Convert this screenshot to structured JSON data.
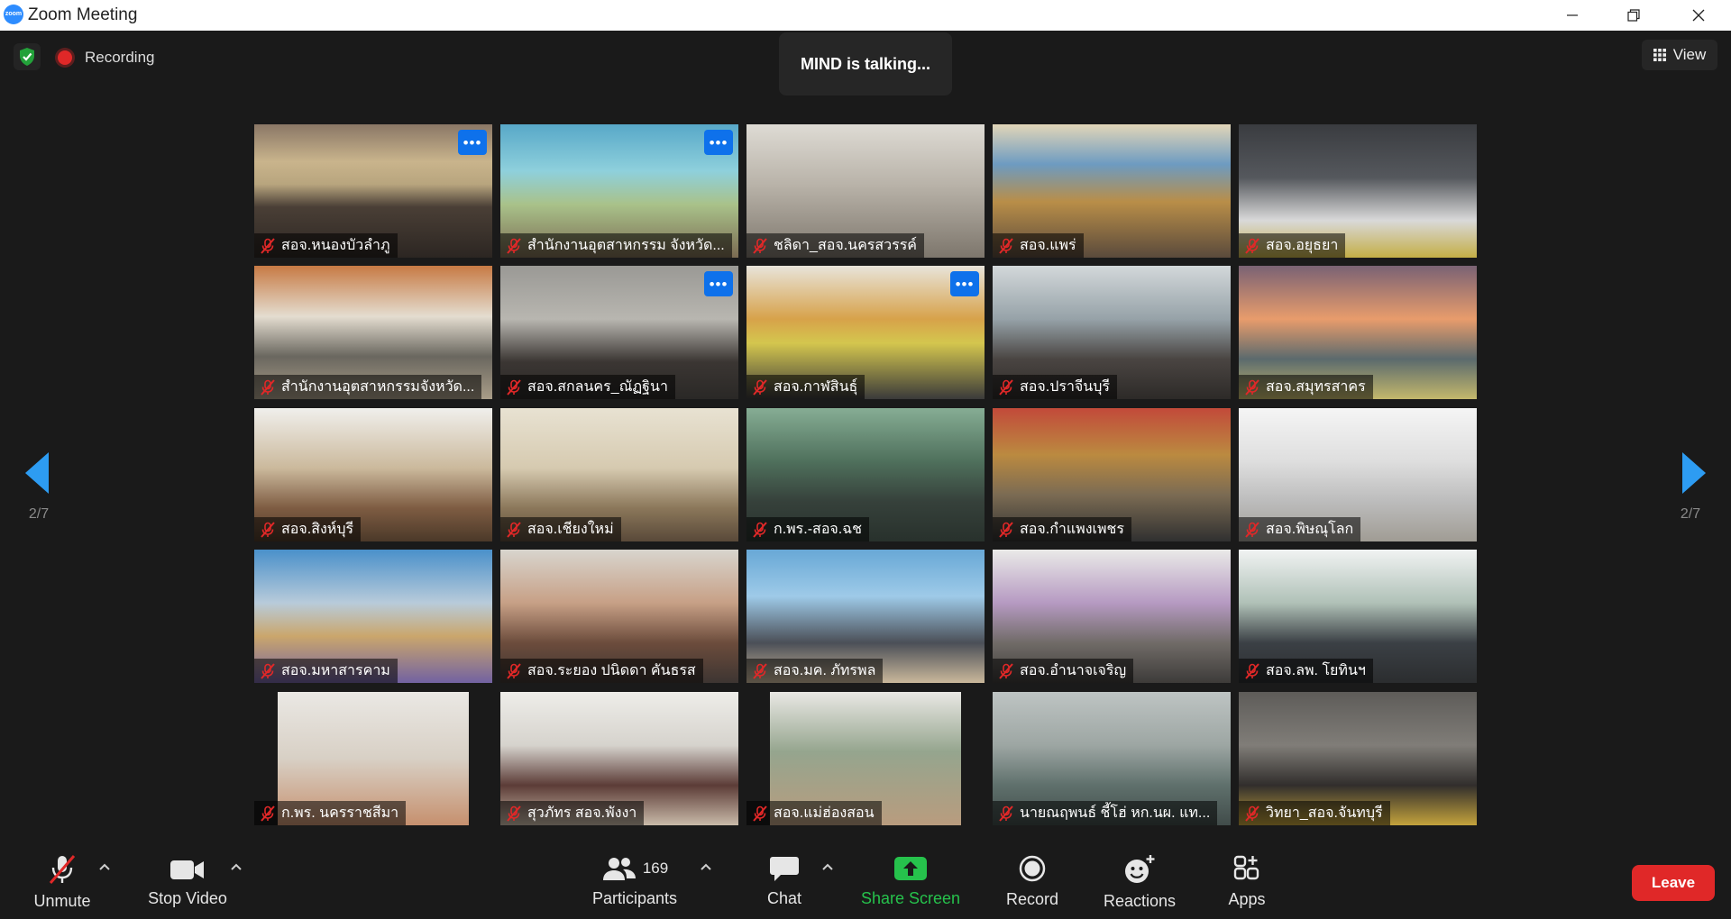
{
  "window": {
    "title": "Zoom Meeting",
    "logo": "zoom"
  },
  "topbar": {
    "recording_label": "Recording",
    "talking_text": "MIND is talking...",
    "view_label": "View"
  },
  "pagination": {
    "left": "2/7",
    "right": "2/7"
  },
  "participants": [
    {
      "name": "สอจ.หนองบัวลำภู",
      "more_button": true
    },
    {
      "name": "สำนักงานอุตสาหกรรม จังหวัด...",
      "more_button": true
    },
    {
      "name": "ชลิดา_สอจ.นครสวรรค์",
      "more_button": false
    },
    {
      "name": "สอจ.แพร่",
      "more_button": false
    },
    {
      "name": "สอจ.อยุธยา",
      "more_button": false
    },
    {
      "name": "สำนักงานอุตสาหกรรมจังหวัด...",
      "more_button": false
    },
    {
      "name": "สอจ.สกลนคร_ณัฏฐินา",
      "more_button": true
    },
    {
      "name": "สอจ.กาฬสินธุ์",
      "more_button": true
    },
    {
      "name": "สอจ.ปราจีนบุรี",
      "more_button": false
    },
    {
      "name": "สอจ.สมุทรสาคร",
      "more_button": false
    },
    {
      "name": "สอจ.สิงห์บุรี",
      "more_button": false
    },
    {
      "name": "สอจ.เชียงใหม่",
      "more_button": false
    },
    {
      "name": "ก.พร.-สอจ.ฉช",
      "more_button": false
    },
    {
      "name": "สอจ.กำแพงเพชร",
      "more_button": false
    },
    {
      "name": "สอจ.พิษณุโลก",
      "more_button": false
    },
    {
      "name": "สอจ.มหาสารคาม",
      "more_button": false
    },
    {
      "name": "สอจ.ระยอง ปนิดดา คันธรส",
      "more_button": false
    },
    {
      "name": "สอจ.มค. ภัทรพล",
      "more_button": false
    },
    {
      "name": "สอจ.อำนาจเจริญ",
      "more_button": false
    },
    {
      "name": "สอจ.ลพ. โยทินฯ",
      "more_button": false
    },
    {
      "name": "ก.พร. นครราชสีมา",
      "more_button": false
    },
    {
      "name": "สุวภัทร สอจ.พังงา",
      "more_button": false
    },
    {
      "name": "สอจ.แม่ฮ่องสอน",
      "more_button": false
    },
    {
      "name": "นายณฤพนธ์ ชี้โฮ่ หก.นผ. แท...",
      "more_button": false
    },
    {
      "name": "วิทยา_สอจ.จันทบุรี",
      "more_button": false
    }
  ],
  "toolbar": {
    "unmute": "Unmute",
    "stop_video": "Stop Video",
    "participants": "Participants",
    "participant_count": "169",
    "chat": "Chat",
    "share_screen": "Share Screen",
    "record": "Record",
    "reactions": "Reactions",
    "apps": "Apps",
    "leave": "Leave"
  },
  "colors": {
    "background": "#1a1a1a",
    "accent_blue": "#2d8cff",
    "more_button_blue": "#0e71eb",
    "nav_arrow_blue": "#2d9cf2",
    "share_green": "#26c24c",
    "leave_red": "#e02828",
    "mic_off_red": "#e02828"
  }
}
